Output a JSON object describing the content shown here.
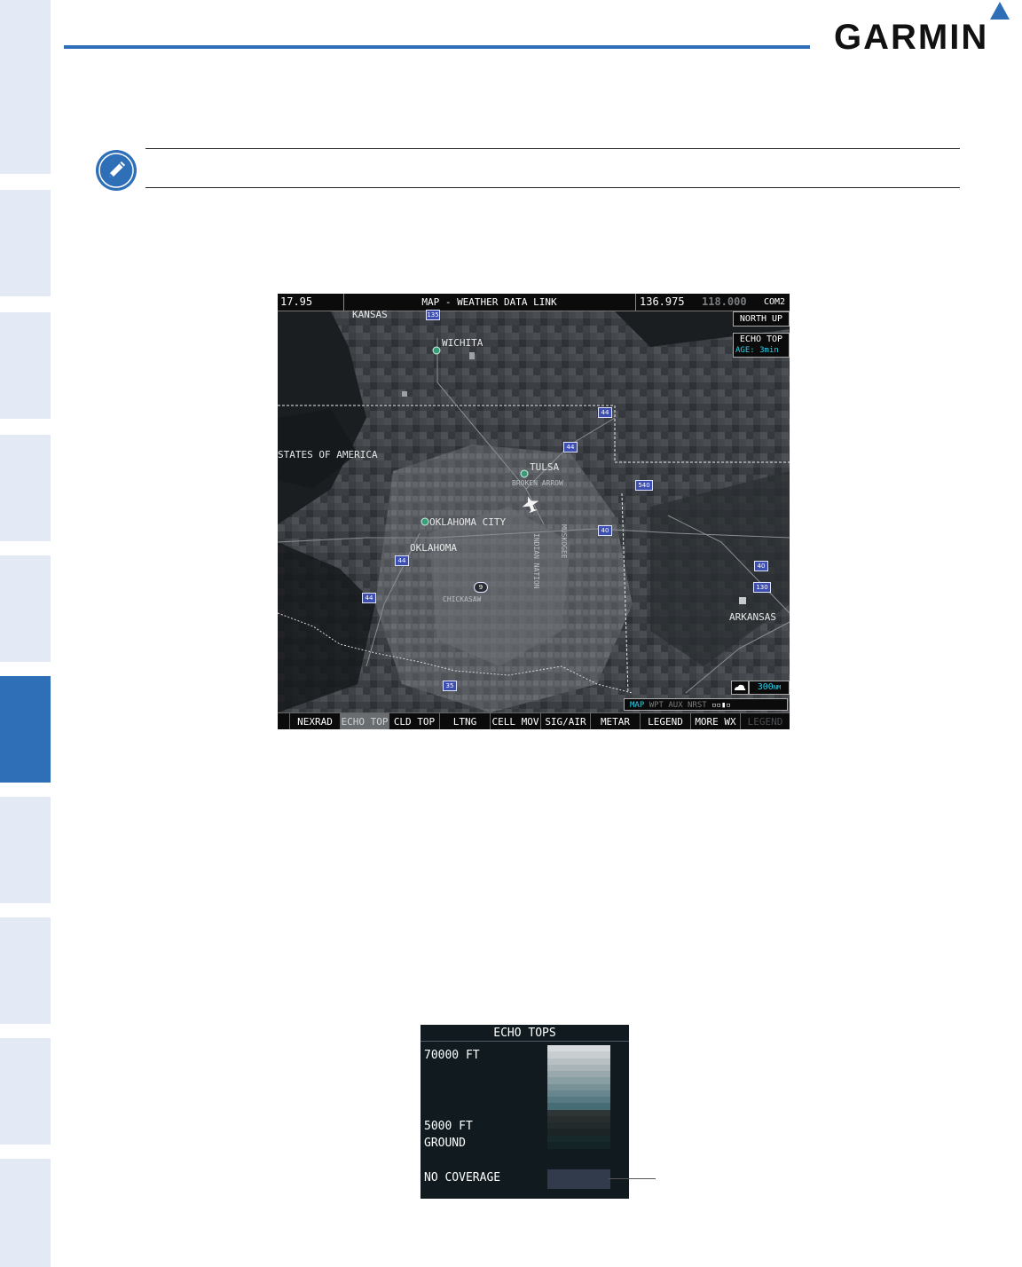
{
  "header": {
    "brand": "GARMIN"
  },
  "sidebar": {
    "active_index": 5,
    "tab_count": 10
  },
  "mfd": {
    "com_left": "17.95",
    "title": "MAP - WEATHER DATA LINK",
    "com_active": "136.975",
    "com_standby": "118.000",
    "com_label": "COM2",
    "orientation": "NORTH UP",
    "product_label": "ECHO TOP",
    "age_label": "AGE:",
    "age_value": "3min",
    "range_value": "300",
    "range_unit": "NM",
    "page_group": {
      "active": "MAP",
      "others": "WPT AUX NRST"
    },
    "map_labels": {
      "kansas": "KANSAS",
      "wichita": "WICHITA",
      "states": "STATES OF AMERICA",
      "tulsa": "TULSA",
      "broken_arrow": "BROKEN ARROW",
      "okc": "OKLAHOMA CITY",
      "oklahoma": "OKLAHOMA",
      "chickasaw": "CHICKASAW",
      "arkansas": "ARKANSAS",
      "muskogee": "MUSKOGEE",
      "indian_nation": "INDIAN NATION",
      "hwy_135": "135",
      "hwy_44a": "44",
      "hwy_44b": "44",
      "hwy_44c": "44",
      "hwy_44d": "44",
      "hwy_540": "540",
      "hwy_40a": "40",
      "hwy_40b": "40",
      "hwy_130": "130",
      "hwy_35": "35",
      "hwy_9": "9"
    },
    "softkeys": [
      "",
      "NEXRAD",
      "ECHO TOP",
      "CLD TOP",
      "LTNG",
      "CELL MOV",
      "SIG/AIR",
      "METAR",
      "LEGEND",
      "MORE WX",
      "LEGEND"
    ],
    "softkey_selected": "ECHO TOP"
  },
  "legend": {
    "title": "ECHO TOPS",
    "top_label": "70000 FT",
    "low_label": "5000 FT",
    "ground_label": "GROUND",
    "no_coverage_label": "NO COVERAGE",
    "scale_colors": [
      "#d7dadc",
      "#c8cdd0",
      "#b9c0c4",
      "#a9b4b8",
      "#98a8ad",
      "#889ea3",
      "#789298",
      "#68868d",
      "#577a82",
      "#466d76",
      "#2e3536",
      "#282d2e",
      "#222a2c",
      "#1c2426",
      "#17292b",
      "#142426"
    ],
    "no_coverage_color": "#323b4c"
  },
  "colors": {
    "accent": "#2f6fb7",
    "sidebar_tab": "#e3eaf5"
  }
}
